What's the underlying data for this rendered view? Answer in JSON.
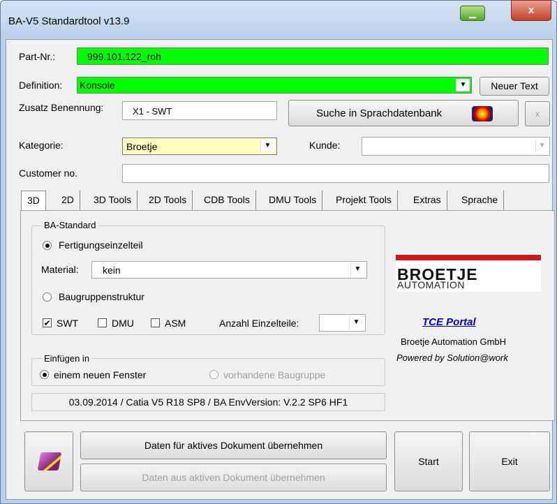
{
  "window": {
    "title": "BA-V5 Standardtool v13.9",
    "min_glyph": "▁",
    "close_glyph": "x"
  },
  "form": {
    "part_label": "Part-Nr.:",
    "part_value": "999.101.122_roh",
    "definition_label": "Definition:",
    "definition_value": "Konsole",
    "neuer_text_button": "Neuer Text",
    "zusatz_label": "Zusatz Benennung:",
    "zusatz_value": "X1 - SWT",
    "suche_button": "Suche in Sprachdatenbank",
    "small_x_button": "x",
    "kategorie_label": "Kategorie:",
    "kategorie_value": "Broetje",
    "kunde_label": "Kunde:",
    "kunde_value": "",
    "customer_label": "Customer no.",
    "customer_value": ""
  },
  "tabs": [
    "3D",
    "2D",
    "3D Tools",
    "2D Tools",
    "CDB Tools",
    "DMU Tools",
    "Projekt Tools",
    "Extras",
    "Sprache"
  ],
  "tab_3d": {
    "group_standard": "BA-Standard",
    "radio_fertigung": "Fertigungseinzelteil",
    "material_label": "Material:",
    "material_value": "kein",
    "radio_baugruppe": "Baugruppenstruktur",
    "check_swt": "SWT",
    "check_dmu": "DMU",
    "check_asm": "ASM",
    "anzahl_label": "Anzahl Einzelteile:",
    "anzahl_value": "",
    "group_einfuegen": "Einfügen in",
    "radio_neues_fenster": "einem neuen Fenster",
    "radio_vorhandene": "vorhandene Baugruppe",
    "status_line": "03.09.2014 / Catia V5 R18 SP8 / BA EnvVersion: V.2.2 SP6 HF1",
    "logo_text_big": "BROETJE",
    "logo_text_small": "AUTOMATION",
    "portal_link": "TCE Portal",
    "company": "Broetje Automation GmbH",
    "powered": "Powered by Solution@work"
  },
  "footer": {
    "daten_uebernehmen": "Daten für aktives Dokument übernehmen",
    "daten_aus": "Daten aus aktiven Dokument übernehmen",
    "start": "Start",
    "exit": "Exit"
  },
  "colors": {
    "green": "#00ff00",
    "yellow": "#ffffc0",
    "link": "#0000cc",
    "logo_red": "#d7141a"
  },
  "icons": {
    "search_icon": "eye-icon",
    "book_icon": "book-icon"
  }
}
